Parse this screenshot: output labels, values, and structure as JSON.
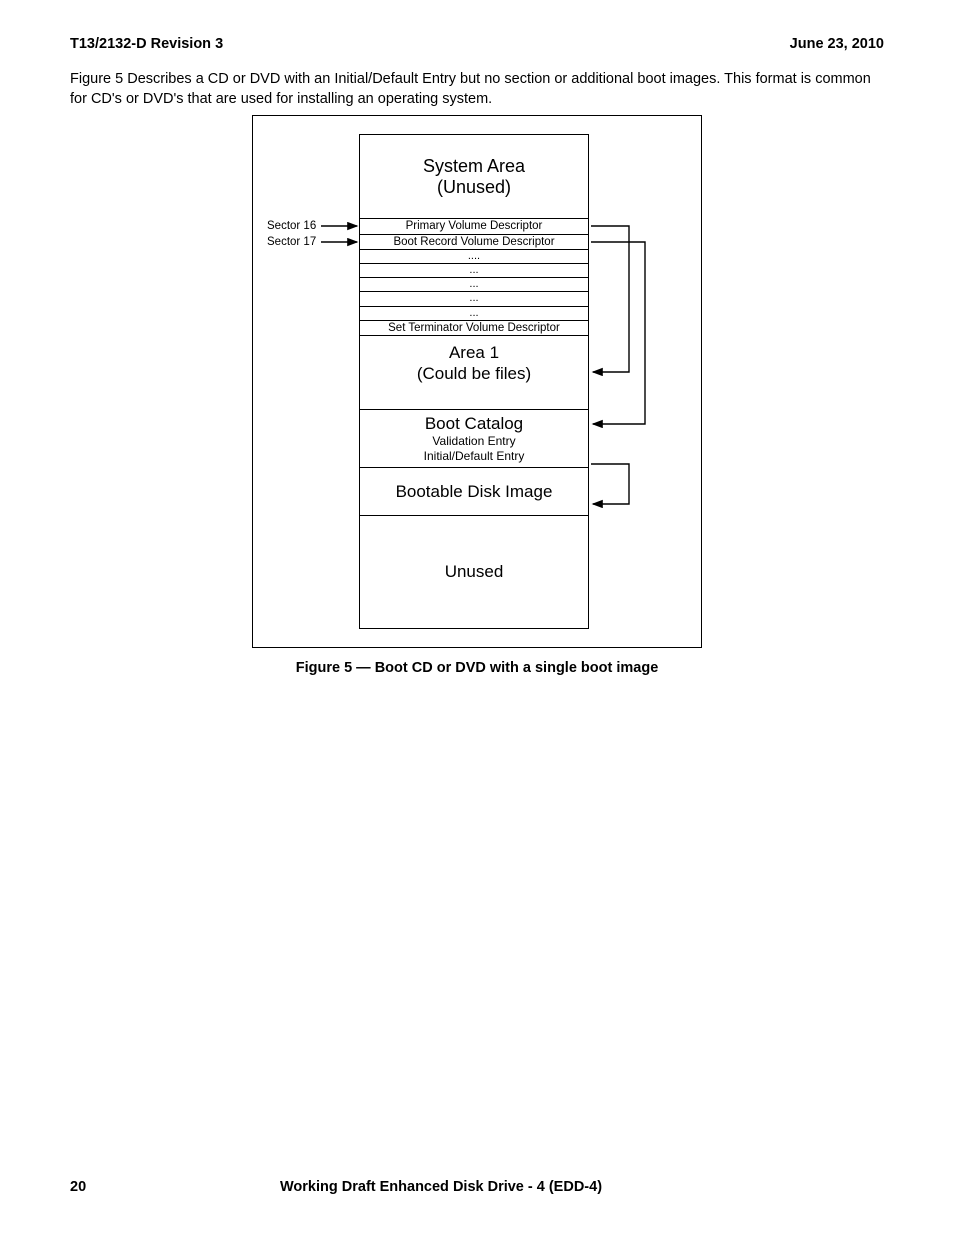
{
  "header": {
    "doc_id": "T13/2132-D Revision 3",
    "date": "June 23, 2010"
  },
  "paragraph": "Figure 5 Describes a CD or DVD with an Initial/Default Entry but no section or additional boot images.  This format is common for CD's or DVD's that are used for installing an operating system.",
  "left_labels": {
    "sector16": "Sector 16",
    "sector17": "Sector 17"
  },
  "stack": {
    "system_area_l1": "System Area",
    "system_area_l2": "(Unused)",
    "pvd": "Primary Volume Descriptor",
    "brvd": "Boot Record Volume Descriptor",
    "dots1": "....",
    "dots2": "...",
    "dots3": "...",
    "dots4": "...",
    "dots5": "...",
    "stvd": "Set Terminator Volume Descriptor",
    "area1_l1": "Area 1",
    "area1_l2": "(Could be files)",
    "bootcat_l1": "Boot Catalog",
    "bootcat_l2": "Validation Entry",
    "bootcat_l3": "Initial/Default Entry",
    "bootimg": "Bootable Disk Image",
    "unused": "Unused"
  },
  "caption": "Figure 5 —  Boot CD or DVD with a single boot image",
  "footer": {
    "page": "20",
    "title": "Working Draft Enhanced Disk Drive - 4  (EDD-4)"
  }
}
